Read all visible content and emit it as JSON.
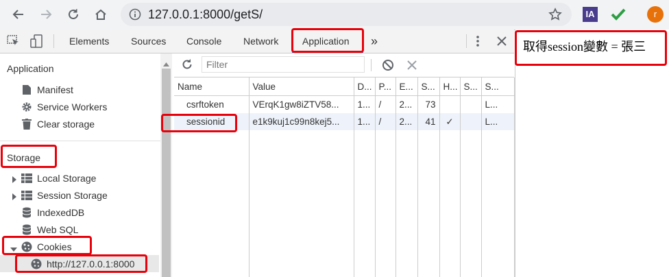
{
  "browser": {
    "url": "127.0.0.1:8000/getS/",
    "profile_initial": "r",
    "ext_ia_label": "IA",
    "colors": {
      "profile": "#e8710a",
      "ext_ia": "#4a3c8c",
      "ext_check": "#2e9e44"
    }
  },
  "devtools": {
    "tabs": [
      "Elements",
      "Sources",
      "Console",
      "Network",
      "Application"
    ],
    "more_tabs": "»",
    "active_tab": "Application",
    "accent": "#1a73e8"
  },
  "sidebar": {
    "application_title": "Application",
    "application_items": [
      {
        "label": "Manifest",
        "icon": "file-icon"
      },
      {
        "label": "Service Workers",
        "icon": "gear-icon"
      },
      {
        "label": "Clear storage",
        "icon": "trash-icon"
      }
    ],
    "storage_title": "Storage",
    "storage_items": [
      {
        "label": "Local Storage",
        "icon": "grid-icon",
        "expander": "collapsed"
      },
      {
        "label": "Session Storage",
        "icon": "grid-icon",
        "expander": "collapsed"
      },
      {
        "label": "IndexedDB",
        "icon": "database-icon"
      },
      {
        "label": "Web SQL",
        "icon": "database-icon"
      },
      {
        "label": "Cookies",
        "icon": "cookie-icon",
        "expander": "expanded"
      }
    ],
    "cookie_origin": "http://127.0.0.1:8000"
  },
  "main": {
    "filter_placeholder": "Filter",
    "columns": [
      "Name",
      "Value",
      "D...",
      "P...",
      "E...",
      "S...",
      "H...",
      "S...",
      "S..."
    ],
    "rows": [
      [
        "csrftoken",
        "VErqK1gw8iZTV58...",
        "1...",
        "/",
        "2...",
        "73",
        "",
        "",
        "L..."
      ],
      [
        "sessionid",
        "e1k9kuj1c99n8kej5...",
        "1...",
        "/",
        "2...",
        "41",
        "✓",
        "",
        "L..."
      ]
    ]
  },
  "annotation": {
    "note": "取得session變數 = 張三",
    "highlight_color": "#e8000a"
  }
}
